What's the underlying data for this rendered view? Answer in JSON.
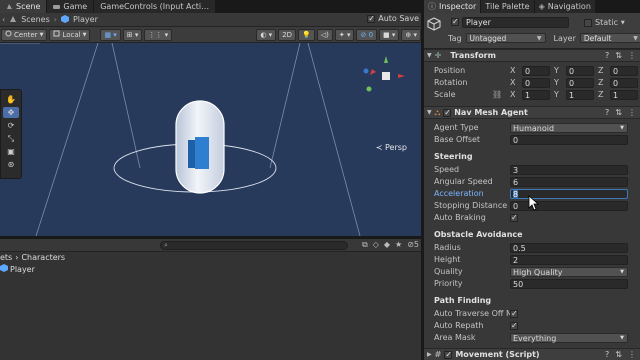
{
  "scene_tabs": [
    {
      "label": "Scene",
      "active": true
    },
    {
      "label": "Game",
      "active": false
    },
    {
      "label": "GameControls (Input Acti…",
      "active": false
    }
  ],
  "breadcrumb": {
    "root": "Scenes",
    "current": "Player",
    "autosave_label": "Auto Save",
    "autosave_checked": true
  },
  "scene_toolbar": {
    "pivot": "Center",
    "space": "Local",
    "mode_2d": "2D"
  },
  "viewport": {
    "projection_label": "≺ Persp",
    "background": "#283a5c"
  },
  "project": {
    "path_prefix": "ets",
    "path_sep": "›",
    "path_folder": "Characters",
    "items": [
      "Player"
    ],
    "hidden_count": "5"
  },
  "inspector": {
    "tabs": [
      {
        "label": "Inspector",
        "active": true
      },
      {
        "label": "Tile Palette",
        "active": false
      },
      {
        "label": "Navigation",
        "active": false
      }
    ],
    "object": {
      "name": "Player",
      "active": true,
      "static_label": "Static",
      "tag_label": "Tag",
      "tag": "Untagged",
      "layer_label": "Layer",
      "layer": "Default"
    },
    "transform": {
      "title": "Transform",
      "rows": [
        {
          "label": "Position",
          "x": "0",
          "y": "0",
          "z": "0"
        },
        {
          "label": "Rotation",
          "x": "0",
          "y": "0",
          "z": "0"
        },
        {
          "label": "Scale",
          "x": "1",
          "y": "1",
          "z": "1"
        }
      ]
    },
    "nav_agent": {
      "title": "Nav Mesh Agent",
      "agent_type_label": "Agent Type",
      "agent_type": "Humanoid",
      "base_offset_label": "Base Offset",
      "base_offset": "0",
      "steering_title": "Steering",
      "speed_label": "Speed",
      "speed": "3",
      "angular_speed_label": "Angular Speed",
      "angular_speed": "6",
      "acceleration_label": "Acceleration",
      "acceleration": "8",
      "stopping_distance_label": "Stopping Distance",
      "stopping_distance": "0",
      "auto_braking_label": "Auto Braking",
      "obstacle_title": "Obstacle Avoidance",
      "radius_label": "Radius",
      "radius": "0.5",
      "height_label": "Height",
      "height": "2",
      "quality_label": "Quality",
      "quality": "High Quality",
      "priority_label": "Priority",
      "priority": "50",
      "pathfinding_title": "Path Finding",
      "auto_traverse_label": "Auto Traverse Off Me",
      "auto_repath_label": "Auto Repath",
      "area_mask_label": "Area Mask",
      "area_mask": "Everything"
    },
    "movement": {
      "title": "Movement (Script)"
    }
  }
}
